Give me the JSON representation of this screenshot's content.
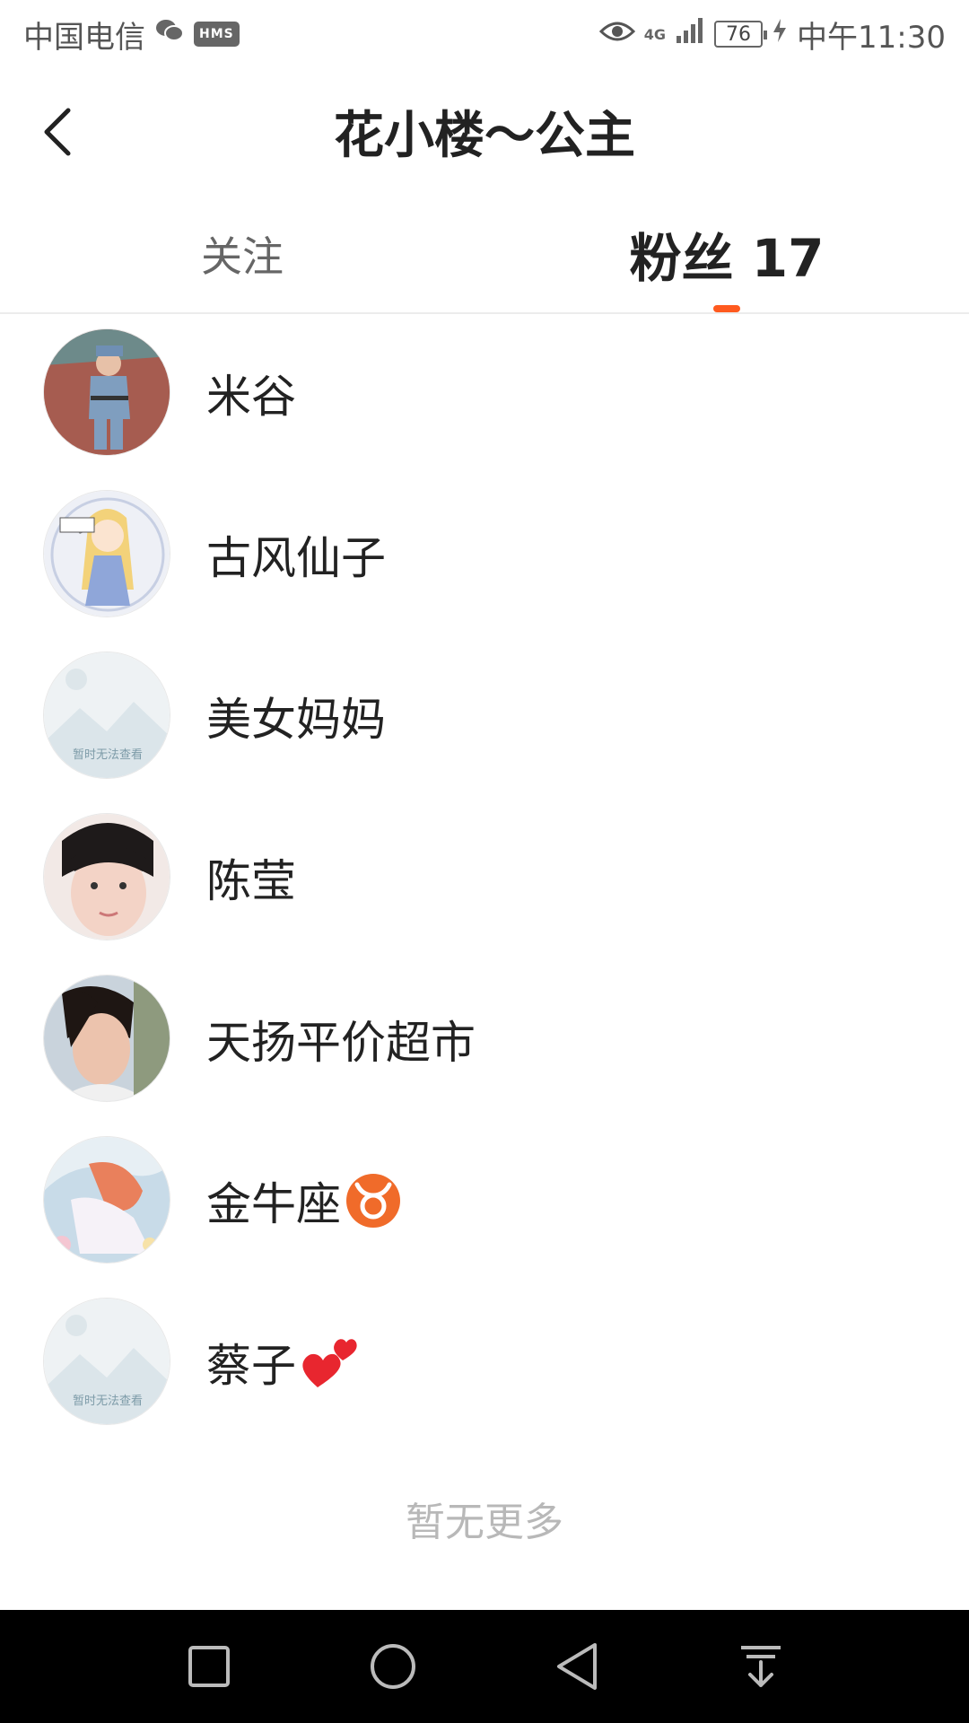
{
  "status_bar": {
    "carrier": "中国电信",
    "hms_label": "HMS",
    "network": "4G",
    "battery": "76",
    "time": "中午11:30"
  },
  "header": {
    "title": "花小楼～公主"
  },
  "tabs": {
    "follow_label": "关注",
    "fans_label": "粉丝 17"
  },
  "fans": [
    {
      "name": "米谷",
      "avatar": "child-soldier-photo"
    },
    {
      "name": "古风仙子",
      "avatar": "anime-girl-illustration"
    },
    {
      "name": "美女妈妈",
      "avatar": "placeholder-image",
      "placeholder_text": "暂时无法查看"
    },
    {
      "name": "陈莹",
      "avatar": "girl-selfie-photo"
    },
    {
      "name": "天扬平价超市",
      "avatar": "woman-portrait-photo"
    },
    {
      "name": "金牛座",
      "avatar": "fantasy-art-illustration",
      "emoji": "taurus-emoji"
    },
    {
      "name": "蔡子",
      "avatar": "placeholder-image",
      "placeholder_text": "暂时无法查看",
      "emoji": "two-hearts-emoji"
    }
  ],
  "footer": {
    "end_text": "暂无更多"
  },
  "colors": {
    "accent": "#ff5a1f",
    "nav_bar": "#000000"
  }
}
